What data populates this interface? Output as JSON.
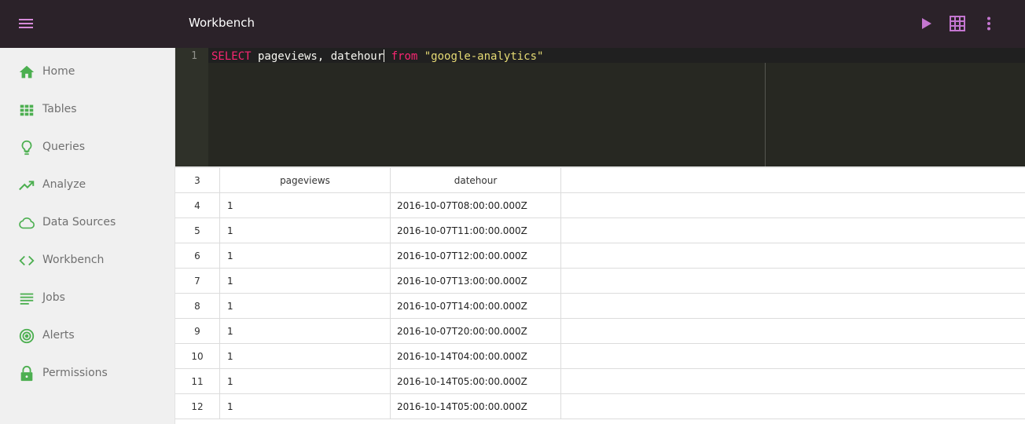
{
  "app": {
    "title": "Workbench"
  },
  "toolbar": {
    "menu_icon": "hamburger-menu-icon",
    "run_icon": "play-icon",
    "grid_icon": "table-grid-icon",
    "more_icon": "more-vert-icon",
    "accent_color": "#c476d0"
  },
  "sidebar": {
    "icon_color": "#4caf50",
    "items": [
      {
        "label": "Home",
        "icon": "home-icon"
      },
      {
        "label": "Tables",
        "icon": "grid-icon"
      },
      {
        "label": "Queries",
        "icon": "lightbulb-icon"
      },
      {
        "label": "Analyze",
        "icon": "trending-up-icon"
      },
      {
        "label": "Data Sources",
        "icon": "cloud-icon"
      },
      {
        "label": "Workbench",
        "icon": "code-icon"
      },
      {
        "label": "Jobs",
        "icon": "list-icon"
      },
      {
        "label": "Alerts",
        "icon": "target-icon"
      },
      {
        "label": "Permissions",
        "icon": "lock-icon"
      }
    ]
  },
  "editor": {
    "line_number": "1",
    "tokens": {
      "kw1": "SELECT",
      "mid": " pageviews, datehour",
      "kw2": "from",
      "str": "\"google-analytics\""
    }
  },
  "grid": {
    "header": {
      "row_no": "3",
      "col1": "pageviews",
      "col2": "datehour"
    },
    "rows": [
      {
        "row_no": "4",
        "pageviews": "1",
        "datehour": "2016-10-07T08:00:00.000Z"
      },
      {
        "row_no": "5",
        "pageviews": "1",
        "datehour": "2016-10-07T11:00:00.000Z"
      },
      {
        "row_no": "6",
        "pageviews": "1",
        "datehour": "2016-10-07T12:00:00.000Z"
      },
      {
        "row_no": "7",
        "pageviews": "1",
        "datehour": "2016-10-07T13:00:00.000Z"
      },
      {
        "row_no": "8",
        "pageviews": "1",
        "datehour": "2016-10-07T14:00:00.000Z"
      },
      {
        "row_no": "9",
        "pageviews": "1",
        "datehour": "2016-10-07T20:00:00.000Z"
      },
      {
        "row_no": "10",
        "pageviews": "1",
        "datehour": "2016-10-14T04:00:00.000Z"
      },
      {
        "row_no": "11",
        "pageviews": "1",
        "datehour": "2016-10-14T05:00:00.000Z"
      },
      {
        "row_no": "12",
        "pageviews": "1",
        "datehour": "2016-10-14T05:00:00.000Z"
      }
    ]
  }
}
